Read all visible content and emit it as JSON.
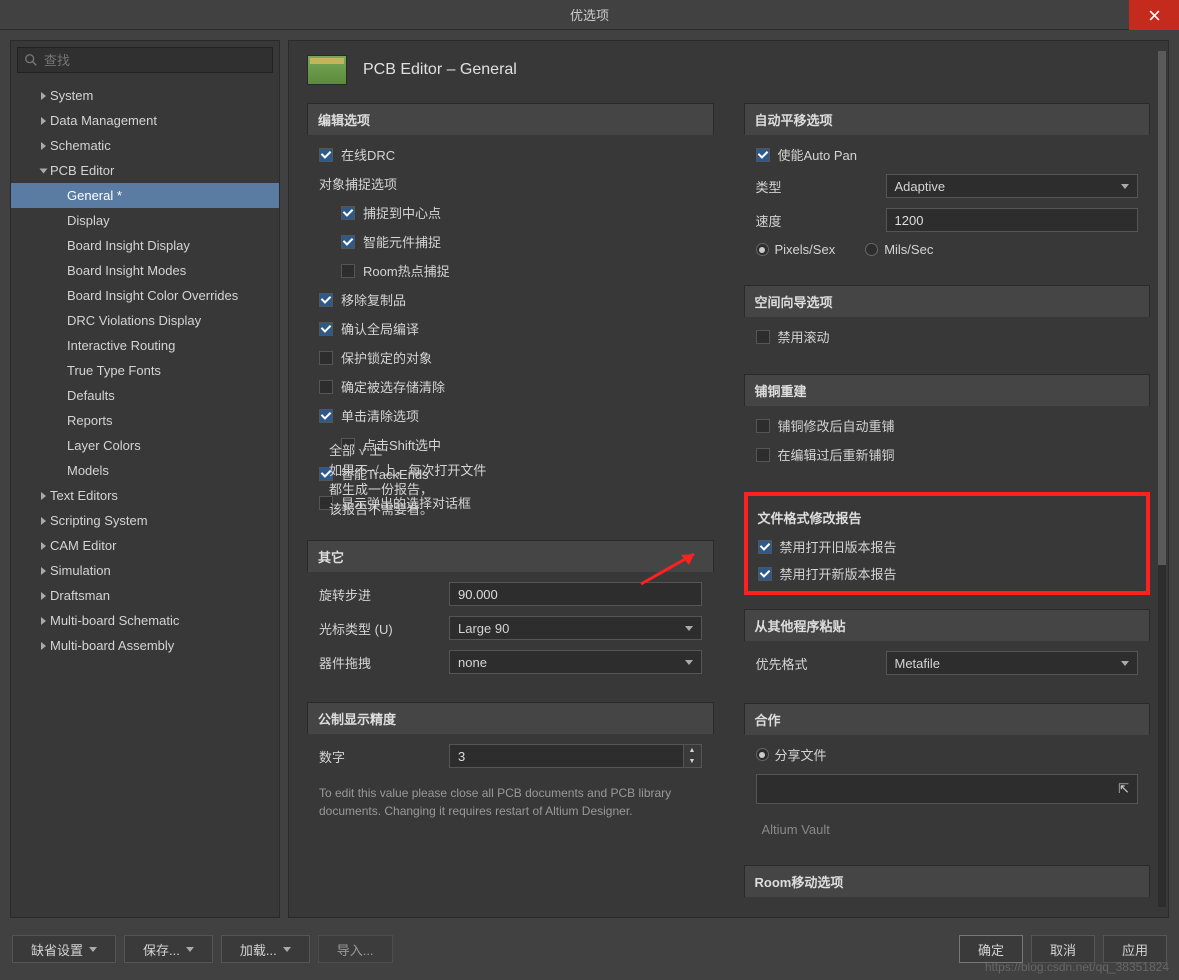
{
  "window": {
    "title": "优选项"
  },
  "search": {
    "placeholder": "查找"
  },
  "tree": {
    "items": [
      {
        "label": "System",
        "lvl": 1,
        "exp": false
      },
      {
        "label": "Data Management",
        "lvl": 1,
        "exp": false
      },
      {
        "label": "Schematic",
        "lvl": 1,
        "exp": false
      },
      {
        "label": "PCB Editor",
        "lvl": 1,
        "exp": true
      },
      {
        "label": "General *",
        "lvl": 2,
        "sel": true
      },
      {
        "label": "Display",
        "lvl": 2
      },
      {
        "label": "Board Insight Display",
        "lvl": 2
      },
      {
        "label": "Board Insight Modes",
        "lvl": 2
      },
      {
        "label": "Board Insight Color Overrides",
        "lvl": 2
      },
      {
        "label": "DRC Violations Display",
        "lvl": 2
      },
      {
        "label": "Interactive Routing",
        "lvl": 2
      },
      {
        "label": "True Type Fonts",
        "lvl": 2
      },
      {
        "label": "Defaults",
        "lvl": 2
      },
      {
        "label": "Reports",
        "lvl": 2
      },
      {
        "label": "Layer Colors",
        "lvl": 2
      },
      {
        "label": "Models",
        "lvl": 2
      },
      {
        "label": "Text Editors",
        "lvl": 1,
        "exp": false
      },
      {
        "label": "Scripting System",
        "lvl": 1,
        "exp": false
      },
      {
        "label": "CAM Editor",
        "lvl": 1,
        "exp": false
      },
      {
        "label": "Simulation",
        "lvl": 1,
        "exp": false
      },
      {
        "label": "Draftsman",
        "lvl": 1,
        "exp": false
      },
      {
        "label": "Multi-board Schematic",
        "lvl": 1,
        "exp": false
      },
      {
        "label": "Multi-board Assembly",
        "lvl": 1,
        "exp": false
      }
    ]
  },
  "page": {
    "title": "PCB Editor – General"
  },
  "left": {
    "edit": {
      "title": "编辑选项",
      "online_drc": {
        "label": "在线DRC",
        "on": true
      },
      "obj_snap": {
        "label": "对象捕捉选项"
      },
      "snap_center": {
        "label": "捕捉到中心点",
        "on": true
      },
      "smart_snap": {
        "label": "智能元件捕捉",
        "on": true
      },
      "room_hot": {
        "label": "Room热点捕捉",
        "on": false
      },
      "remove_dup": {
        "label": "移除复制品",
        "on": true
      },
      "confirm_global": {
        "label": "确认全局编译",
        "on": true
      },
      "protect_locked": {
        "label": "保护锁定的对象",
        "on": false
      },
      "confirm_sel_clear": {
        "label": "确定被选存储清除",
        "on": false
      },
      "click_clear": {
        "label": "单击清除选项",
        "on": true
      },
      "shift_click": {
        "label": "点击Shift选中",
        "on": false
      },
      "smart_trackends": {
        "label": "智能TrackEnds",
        "on": true
      },
      "show_popup": {
        "label": "显示弹出的选择对话框",
        "on": false
      }
    },
    "other": {
      "title": "其它",
      "rot_step": {
        "label": "旋转步进",
        "value": "90.000"
      },
      "cursor": {
        "label": "光标类型 (U)",
        "value": "Large 90"
      },
      "drag": {
        "label": "器件拖拽",
        "value": "none"
      }
    },
    "metric": {
      "title": "公制显示精度",
      "digits": {
        "label": "数字",
        "value": "3"
      },
      "hint": "To edit this value please close all PCB documents and PCB library documents. Changing it requires restart of Altium Designer."
    }
  },
  "right": {
    "autopan": {
      "title": "自动平移选项",
      "enable": {
        "label": "使能Auto Pan",
        "on": true
      },
      "type": {
        "label": "类型",
        "value": "Adaptive"
      },
      "speed": {
        "label": "速度",
        "value": "1200"
      },
      "r1": "Pixels/Sex",
      "r2": "Mils/Sec"
    },
    "space": {
      "title": "空间向导选项",
      "disable_roll": {
        "label": "禁用滚动",
        "on": false
      }
    },
    "repour": {
      "title": "铺铜重建",
      "auto": {
        "label": "铺铜修改后自动重铺",
        "on": false
      },
      "edit": {
        "label": "在编辑过后重新铺铜",
        "on": false
      }
    },
    "report": {
      "title": "文件格式修改报告",
      "old": {
        "label": "禁用打开旧版本报告",
        "on": true
      },
      "new": {
        "label": "禁用打开新版本报告",
        "on": true
      }
    },
    "paste": {
      "title": "从其他程序粘贴",
      "fmt": {
        "label": "优先格式",
        "value": "Metafile"
      }
    },
    "collab": {
      "title": "合作",
      "share": {
        "label": "分享文件"
      },
      "vault": "Altium Vault"
    },
    "room": {
      "title": "Room移动选项"
    }
  },
  "annot": {
    "l1": "全部 √ 上",
    "l2": "如果不 √ 上，每次打开文件",
    "l3": "都生成一份报告，",
    "l4": "该报告不需要看。"
  },
  "footer": {
    "defaults": "缺省设置",
    "save": "保存...",
    "load": "加载...",
    "import": "导入...",
    "ok": "确定",
    "cancel": "取消",
    "apply": "应用"
  },
  "watermark": "https://blog.csdn.net/qq_38351824"
}
